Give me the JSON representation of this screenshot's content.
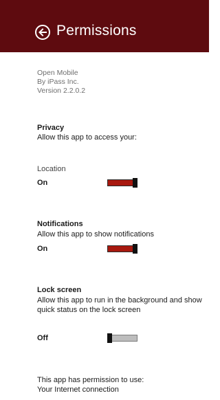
{
  "header": {
    "title": "Permissions",
    "back_icon": "back-arrow-icon",
    "background": "#5e0b0f"
  },
  "app": {
    "name": "Open Mobile",
    "publisher": "By iPass Inc.",
    "version": "Version 2.2.0.2"
  },
  "privacy": {
    "title": "Privacy",
    "description": "Allow this app to access your:"
  },
  "location": {
    "label": "Location",
    "state": "On",
    "enabled": true
  },
  "notifications": {
    "title": "Notifications",
    "description": "Allow this app to show notifications",
    "state": "On",
    "enabled": true
  },
  "lock_screen": {
    "title": "Lock screen",
    "description": "Allow this app to run in the background and show quick status on the lock screen",
    "state": "Off",
    "enabled": false
  },
  "permissions": {
    "heading": "This app has permission to use:",
    "items": [
      "Your Internet connection"
    ]
  },
  "colors": {
    "toggle_on": "#a8190f",
    "toggle_off": "#bdbdbd"
  }
}
